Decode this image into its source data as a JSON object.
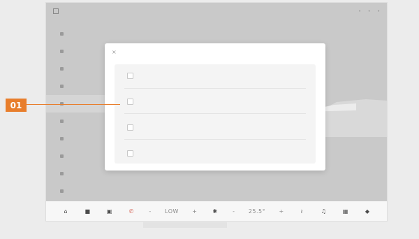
{
  "callout": {
    "label": "01",
    "color": "#e87e2c"
  },
  "statusbar": {
    "items": [
      "",
      "",
      "",
      "",
      "",
      "",
      "",
      "",
      ""
    ]
  },
  "sidebar": {
    "items": [
      {
        "label": "",
        "active": false
      },
      {
        "label": "",
        "active": false
      },
      {
        "label": "",
        "active": false
      },
      {
        "label": "",
        "active": false
      },
      {
        "label": "",
        "active": true
      },
      {
        "label": "",
        "active": false
      },
      {
        "label": "",
        "active": false
      },
      {
        "label": "",
        "active": false
      },
      {
        "label": "",
        "active": false
      },
      {
        "label": "",
        "active": false
      }
    ]
  },
  "modal": {
    "title": "",
    "options": [
      {
        "title": "",
        "desc": ""
      },
      {
        "title": "",
        "desc": ""
      },
      {
        "title": "",
        "desc": ""
      },
      {
        "title": "",
        "desc": ""
      }
    ]
  },
  "dock": {
    "fan_label": "LOW",
    "temp_label": "25.5°",
    "minus": "-",
    "plus": "+"
  }
}
